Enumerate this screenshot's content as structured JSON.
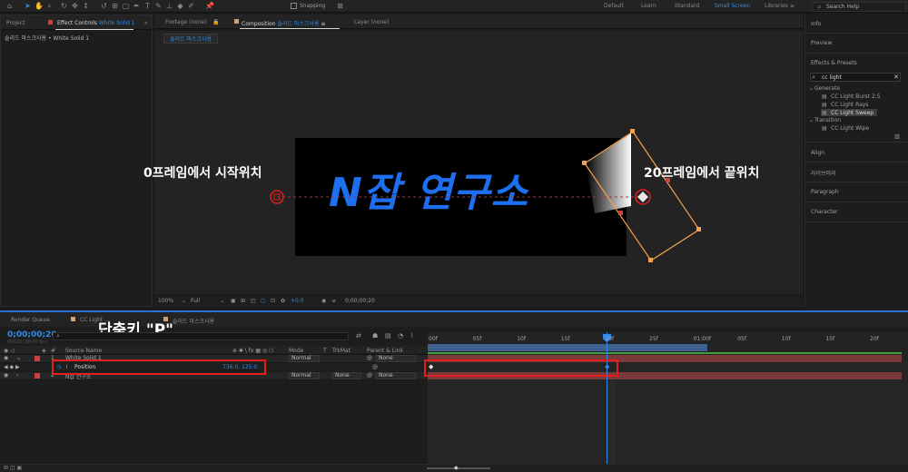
{
  "toolbar": {
    "snapping_label": "Snapping",
    "workspaces": [
      "Default",
      "Learn",
      "Standard",
      "Small Screen",
      "Libraries"
    ],
    "active_workspace": "Small Screen",
    "search_placeholder": "Search Help"
  },
  "left_panel": {
    "tab_project": "Project",
    "tab_effect_controls": "Effect Controls",
    "effect_controls_layer": "White Solid 1",
    "breadcrumb": "솔리드 마스크사용 • White Solid 1"
  },
  "viewer": {
    "tab_footage": "Footage  (none)",
    "tab_composition": "Composition",
    "composition_name": "솔리드 마스크사용",
    "tab_layer": "Layer  (none)",
    "comp_chip": "솔리드 마스크사용",
    "comp_text": "N잡 연구소",
    "annotation_start": "0프레임에서 시작위치",
    "annotation_end": "20프레임에서 끝위치",
    "bottom_bar": {
      "zoom": "100%",
      "resolution": "Full",
      "exposure": "+0.0",
      "timecode": "0;00;00;20"
    }
  },
  "right_panel": {
    "info": "Info",
    "preview": "Preview",
    "effects_presets": "Effects & Presets",
    "search_value": "cc light",
    "tree": [
      {
        "label": "Generate",
        "items": [
          "CC Light Burst 2.5",
          "CC Light Rays",
          "CC Light Sweep"
        ]
      },
      {
        "label": "Transition",
        "items": [
          "CC Light Wipe"
        ]
      }
    ],
    "selected_item": "CC Light Sweep",
    "align": "Align",
    "library": "라이브러리",
    "paragraph": "Paragraph",
    "character": "Character"
  },
  "timeline": {
    "tab_render_queue": "Render Queue",
    "tab_cc_light": "CC Light ...",
    "tab_comp": "솔리드 마스크사용",
    "timecode": "0;00;00;20",
    "timecode_sub": "00020 (30.00 fps)",
    "shortcut_note": "단축키 \"P\"",
    "columns": {
      "source_name": "Source Name",
      "mode": "Mode",
      "t": "T",
      "trkmat": "TrkMat",
      "parent": "Parent & Link"
    },
    "layers": [
      {
        "num": "1",
        "name": "White Solid 1",
        "mode": "Normal",
        "trkmat": "",
        "parent": "None"
      },
      {
        "num": "2",
        "name": "N잡 연구소",
        "mode": "Normal",
        "trkmat": "None",
        "parent": "None"
      }
    ],
    "property": {
      "name": "Position",
      "value": "736.0, 125.0"
    },
    "ruler_ticks": [
      "00f",
      "05f",
      "10f",
      "15f",
      "20f",
      "25f",
      "01:00f",
      "05f",
      "10f",
      "15f",
      "20f"
    ]
  },
  "colors": {
    "accent_blue": "#2d8ceb",
    "annotation_red": "#e41e1e",
    "comp_text_blue": "#1e6ef0",
    "layer_bar_red": "#7a3a3a",
    "mask_path_orange": "#f0a050"
  }
}
